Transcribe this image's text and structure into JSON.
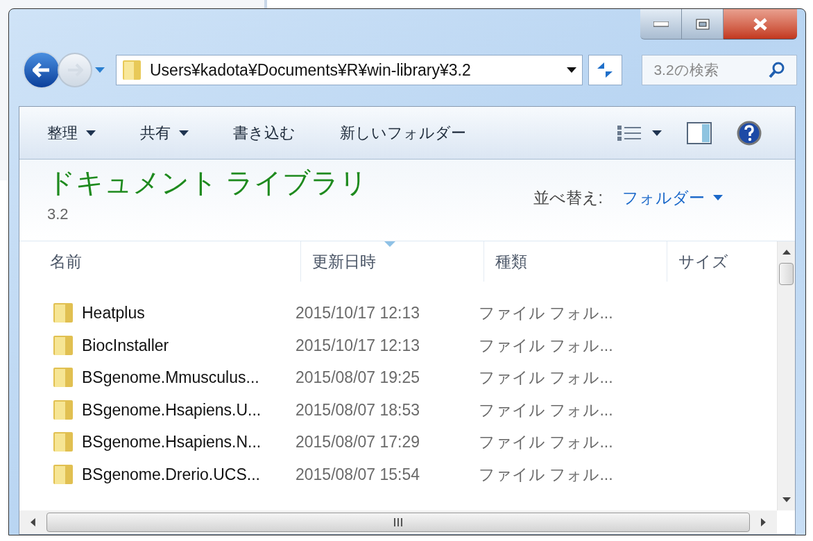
{
  "window": {
    "controls": [
      {
        "kind": "minimize"
      },
      {
        "kind": "maximize"
      },
      {
        "kind": "close"
      }
    ]
  },
  "address": {
    "path": "Users¥kadota¥Documents¥R¥win-library¥3.2"
  },
  "search": {
    "placeholder": "3.2の検索"
  },
  "toolbar": [
    {
      "label": "整理",
      "dropdown": true
    },
    {
      "label": "共有",
      "dropdown": true
    },
    {
      "label": "書き込む",
      "dropdown": false
    },
    {
      "label": "新しいフォルダー",
      "dropdown": false
    }
  ],
  "library": {
    "title": "ドキュメント ライブラリ",
    "subtitle": "3.2",
    "sort_label": "並べ替え:",
    "sort_value": "フォルダー"
  },
  "table": {
    "columns": [
      {
        "label": "名前",
        "sorted": false
      },
      {
        "label": "更新日時",
        "sorted": true
      },
      {
        "label": "種類",
        "sorted": false
      },
      {
        "label": "サイズ",
        "sorted": false
      }
    ],
    "rows": [
      {
        "name": "Heatplus",
        "modified": "2015/10/17 12:13",
        "type": "ファイル フォル..."
      },
      {
        "name": "BiocInstaller",
        "modified": "2015/10/17 12:13",
        "type": "ファイル フォル..."
      },
      {
        "name": "BSgenome.Mmusculus...",
        "modified": "2015/08/07 19:25",
        "type": "ファイル フォル..."
      },
      {
        "name": "BSgenome.Hsapiens.U...",
        "modified": "2015/08/07 18:53",
        "type": "ファイル フォル..."
      },
      {
        "name": "BSgenome.Hsapiens.N...",
        "modified": "2015/08/07 17:29",
        "type": "ファイル フォル..."
      },
      {
        "name": "BSgenome.Drerio.UCS...",
        "modified": "2015/08/07 15:54",
        "type": "ファイル フォル..."
      }
    ]
  }
}
